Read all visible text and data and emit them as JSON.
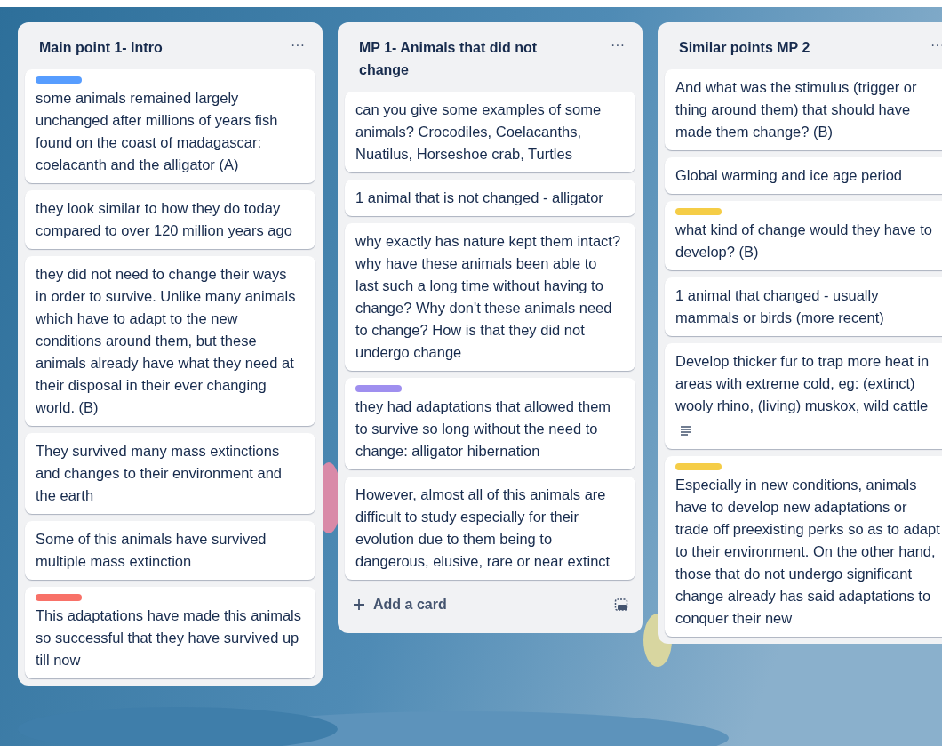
{
  "lists": [
    {
      "title": "Main point 1- Intro",
      "menu": "···",
      "cards": [
        {
          "color": "#579dff",
          "text": "some animals remained largely unchanged after millions of years fish found on the coast of madagascar: coelacanth and the alligator (A)",
          "has_description": false
        },
        {
          "text": "they look similar to how they do today compared to over 120 million years ago",
          "has_description": false
        },
        {
          "text": "they did not need to change their ways in order to survive. Unlike many animals which have to adapt to the new conditions around them, but these animals already have what they need at their disposal in their ever changing world. (B)",
          "has_description": false
        },
        {
          "text": "They survived many mass extinctions and changes to their environment and the earth",
          "has_description": false
        },
        {
          "text": "Some of this animals have survived multiple mass extinction",
          "has_description": false
        },
        {
          "color": "#f87168",
          "text": "This adaptations have made this animals so successful that they have survived up till now",
          "has_description": false
        }
      ]
    },
    {
      "title": "MP 1- Animals that did not change",
      "menu": "···",
      "cards": [
        {
          "text": "can you give some examples of some animals? Crocodiles, Coelacanths, Nuatilus, Horseshoe crab, Turtles",
          "has_description": false
        },
        {
          "text": "1 animal that is not changed - alligator",
          "has_description": false
        },
        {
          "text": "why exactly has nature kept them intact? why have these animals been able to last such a long time without having to change? Why don't these animals need to change? How is that they did not undergo change",
          "has_description": false
        },
        {
          "color": "#9f8fef",
          "text": "they had adaptations that allowed them to survive so long without the need to change: alligator hibernation",
          "has_description": false
        },
        {
          "text": "However, almost all of this animals are difficult to study especially for their evolution due to them being to dangerous, elusive, rare or near extinct",
          "has_description": false
        }
      ],
      "add_card": "Add a card"
    },
    {
      "title": "Similar points MP 2",
      "menu": "···",
      "cards": [
        {
          "text": "And what was the stimulus (trigger or thing around them) that should have made them change? (B)",
          "has_description": false
        },
        {
          "text": "Global warming and ice age period",
          "has_description": false
        },
        {
          "color": "#f5cd47",
          "text": "what kind of change would they have to develop? (B)",
          "has_description": false
        },
        {
          "text": "1 animal that changed - usually mammals or birds (more recent)",
          "has_description": false
        },
        {
          "text": "Develop thicker fur to trap more heat in areas with extreme cold, eg: (extinct) wooly rhino, (living) muskox, wild cattle",
          "has_description": true
        },
        {
          "color": "#f5cd47",
          "text": "Especially in new conditions, animals have to develop new adaptations or trade off preexisting perks so as to adapt to their environment. On the other hand, those that do not undergo significant change already has said adaptations to conquer their new",
          "has_description": false
        }
      ]
    }
  ]
}
